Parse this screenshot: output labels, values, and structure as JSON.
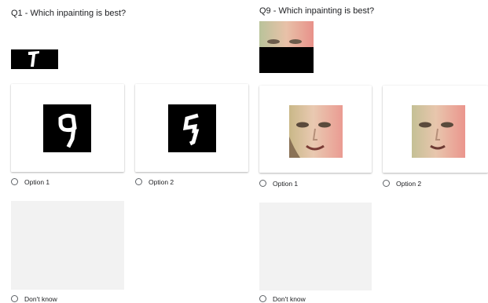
{
  "questions": [
    {
      "title": "Q1 - Which inpainting is best?",
      "image_kind": "digit",
      "options": [
        {
          "label": "Option 1"
        },
        {
          "label": "Option 2"
        }
      ],
      "dont_know": "Don't know"
    },
    {
      "title": "Q9 - Which inpainting is best?",
      "image_kind": "face",
      "options": [
        {
          "label": "Option 1"
        },
        {
          "label": "Option 2"
        }
      ],
      "dont_know": "Don't know"
    }
  ],
  "colors": {
    "card_shadow": "#bdbdbd",
    "placeholder": "#f2f2f2",
    "radio_border": "#5f6368"
  }
}
